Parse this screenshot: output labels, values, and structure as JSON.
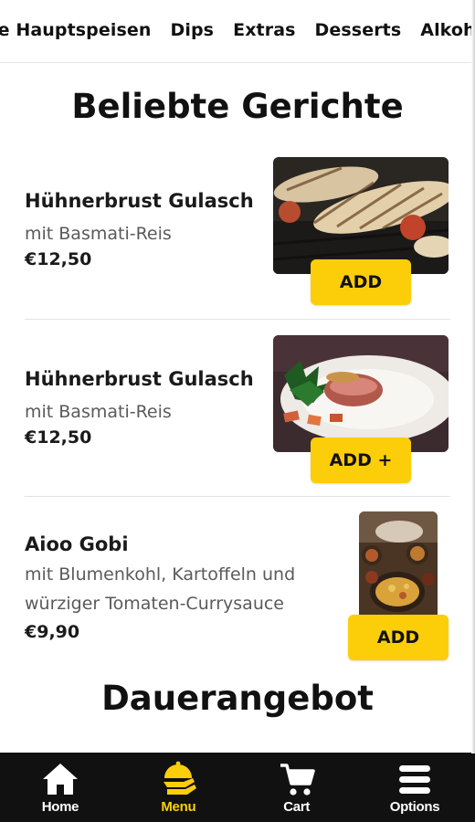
{
  "categories": [
    "he Hauptspeisen",
    "Dips",
    "Extras",
    "Desserts",
    "Alkoh"
  ],
  "sections": {
    "popular_title": "Beliebte Gerichte",
    "permanent_title": "Dauerangebot"
  },
  "dishes": [
    {
      "name": "Hühnerbrust Gulasch",
      "description": "mit Basmati-Reis",
      "price": "€12,50",
      "button": "ADD"
    },
    {
      "name": "Hühnerbrust Gulasch",
      "description": "mit Basmati-Reis",
      "price": "€12,50",
      "button": "ADD +"
    },
    {
      "name": "Aioo Gobi",
      "description": "mit Blumenkohl, Kartoffeln und würziger Tomaten-Currysauce",
      "price": "€9,90",
      "button": "ADD"
    }
  ],
  "nav": {
    "home": "Home",
    "menu": "Menu",
    "cart": "Cart",
    "options": "Options",
    "active": "menu"
  },
  "colors": {
    "accent": "#fcce0a",
    "nav_background": "#111111",
    "text": "#111111"
  }
}
